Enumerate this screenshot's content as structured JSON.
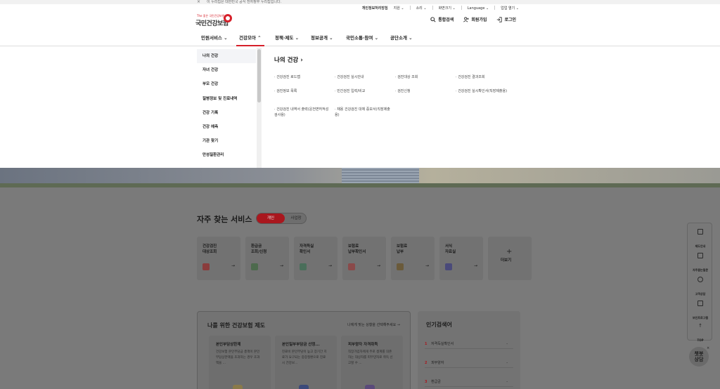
{
  "notice": {
    "close": "×",
    "text": "이 누리집은 대한민국 공식 전자정부 누리집입니다."
  },
  "util": [
    "개인정보처리방침",
    "지원 ⌄",
    "소리 ⌄",
    "화면크기 ⌄",
    "Language ⌄",
    "업업 열기 ⌄"
  ],
  "logo": {
    "sub": "The 좋은 국민건강보험",
    "name": "국민건강보험"
  },
  "tools": {
    "search": "통합검색",
    "join": "회원가입",
    "login": "로그인"
  },
  "gnb": [
    "민원서비스 ⌄",
    "건강모아 ⌃",
    "정책·제도 ⌄",
    "정보공개 ⌄",
    "국민소통·참여 ⌄",
    "공단소개 ⌄"
  ],
  "lnb": [
    "나의 건강",
    "자녀 건강",
    "부모 건강",
    "질병정보 및 진료내역",
    "건강 기록",
    "건강 예측",
    "기관 찾기",
    "만성질환관리"
  ],
  "panel": {
    "title": "나의 건강 ›",
    "links": [
      "건강검진 로드맵",
      "건강검진 실시안내",
      "검진대상 조회",
      "건강검진 결과조회",
      "검진정보 목록",
      "민간검진 입력/비교",
      "검진신청",
      "건강검진 실시확인서(직장제출용)",
      "건강검진 내역서 출력(운전면허적성검사용)",
      "채용 건강검진 대체 증보서(직장제출용)"
    ]
  },
  "frequent": {
    "title": "자주 찾는 서비스",
    "toggle_on": "개인",
    "toggle_off": "사업장",
    "cards": [
      "건강검진\n대상조회",
      "환급금\n조회/신청",
      "자격득실\n확인서",
      "보험료\n납부확인서",
      "보험료\n납부",
      "서식\n자료실"
    ],
    "arrow": "→",
    "more_plus": "+",
    "more_label": "더보기"
  },
  "benefits": {
    "title": "나를 위한 건강보험 제도",
    "more": "나에게 맞는 상황을 선택해주세요 →",
    "items": [
      {
        "title": "본인부담상한제",
        "desc": "건강보험 본인부담금 총액이 본인부담상한액을 초과하는 경우 초과액을 ..."
      },
      {
        "title": "본인일부부담금 산정...",
        "desc": "진료비 본인부담이 높고 장기간 치료가 요구되는 중증질환으로 진료 시 건강보..."
      },
      {
        "title": "피부양자 자격취득",
        "desc": "직장가입자에게 주로 생계를 의존하는 대상자를 피부양자로 취득 신고할 수 ..."
      }
    ]
  },
  "popular": {
    "title": "인기검색어",
    "items": [
      {
        "rank": "1",
        "term": "자격득실확인서",
        "delta": "-"
      },
      {
        "rank": "2",
        "term": "피부양자",
        "delta": "-"
      },
      {
        "rank": "3",
        "term": "환급금",
        "delta": "-"
      }
    ]
  },
  "quick": [
    "제도안내",
    "자주묻는질문",
    "고객상담",
    "보인트로그램",
    "TOP"
  ],
  "quick_top_arrow": "↑",
  "chatbot": {
    "label": "챗봇\n상담",
    "close": "×"
  },
  "colors": {
    "brand": "#d6202a",
    "toggle_on": "#a9171e"
  }
}
